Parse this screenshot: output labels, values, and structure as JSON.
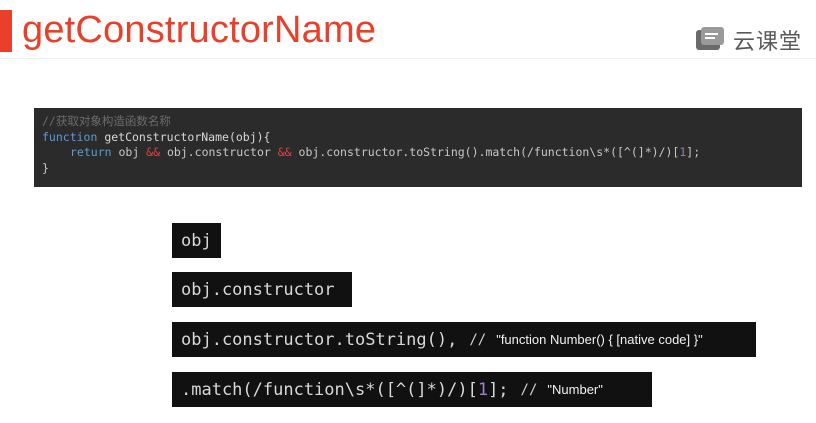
{
  "slide": {
    "title": "getConstructorName",
    "accent_color": "#e8402a"
  },
  "brand": {
    "name": "云课堂",
    "icon": "cloud-classroom-logo-icon"
  },
  "code": {
    "comment": "//获取对象构造函数名称",
    "line2_kw": "function",
    "line2_rest": " getConstructorName(obj){",
    "line3_return": "return",
    "line3_obj1": " obj ",
    "line3_amp1": "&&",
    "line3_mid": " obj.constructor ",
    "line3_amp2": "&&",
    "line3_tail_a": " obj.constructor.toString().match(/function\\s*([^(]*)/)[",
    "line3_num": "1",
    "line3_tail_b": "];",
    "line4": "}"
  },
  "snippets": {
    "s1": "obj",
    "s2": "obj.constructor",
    "s3_code": "obj.constructor.toString(),",
    "s3_slashes": "//",
    "s3_note": "\"function Number() { [native code] }\"",
    "s4_code_a": ".match(/function\\s*([^(]*)/)[",
    "s4_num": "1",
    "s4_code_b": "];",
    "s4_slashes": "//",
    "s4_note": "\"Number\""
  }
}
